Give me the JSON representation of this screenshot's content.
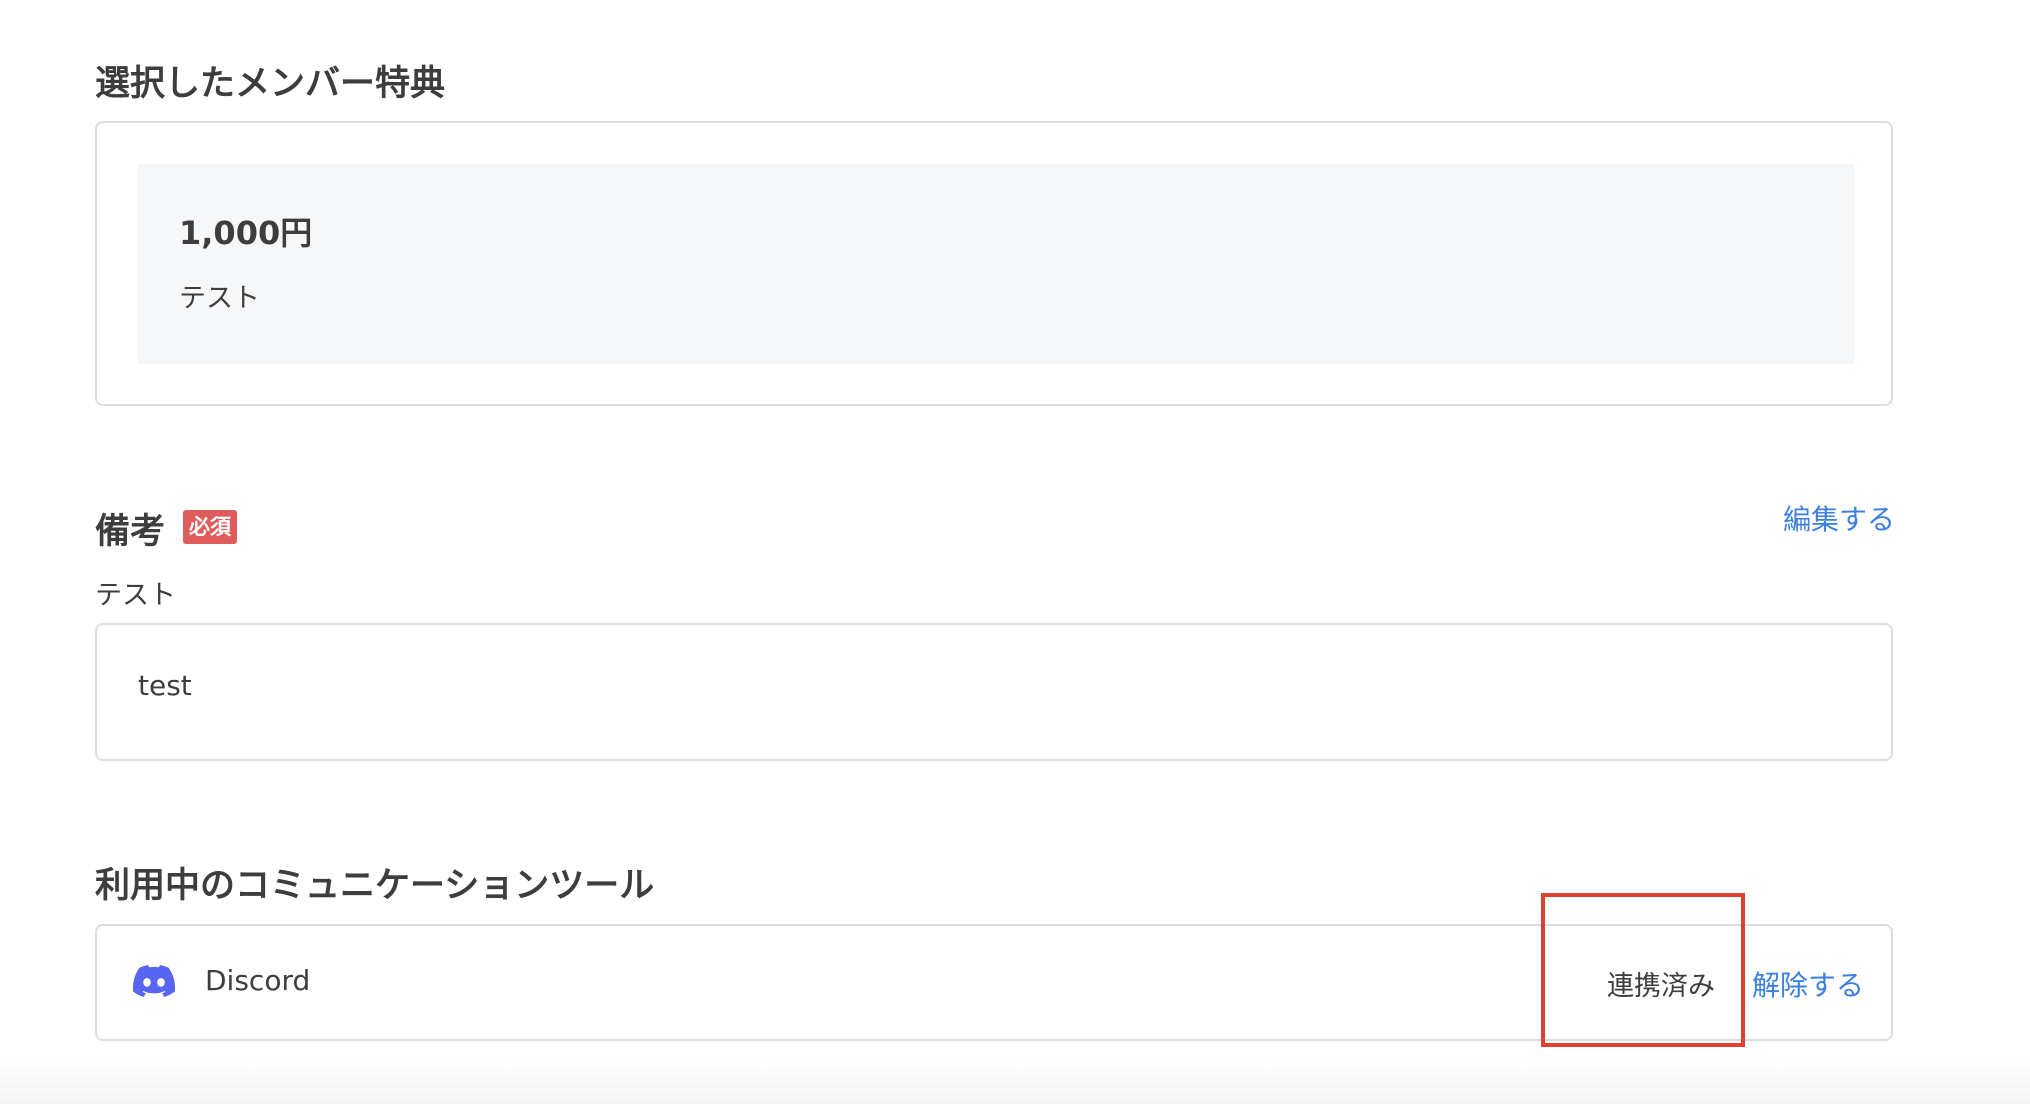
{
  "perk_section": {
    "title": "選択したメンバー特典",
    "price": "1,000円",
    "description": "テスト"
  },
  "notes_section": {
    "title": "備考",
    "required_badge": "必須",
    "edit_link": "編集する",
    "label": "テスト",
    "value": "test"
  },
  "tools_section": {
    "title": "利用中のコミュニケーションツール",
    "tool": {
      "icon": "discord-icon",
      "name": "Discord",
      "status": "連携済み",
      "disconnect_link": "解除する"
    }
  },
  "colors": {
    "link": "#3b7fe0",
    "required_badge": "#de5c5c",
    "discord": "#5865f2",
    "highlight": "#e0402e"
  }
}
